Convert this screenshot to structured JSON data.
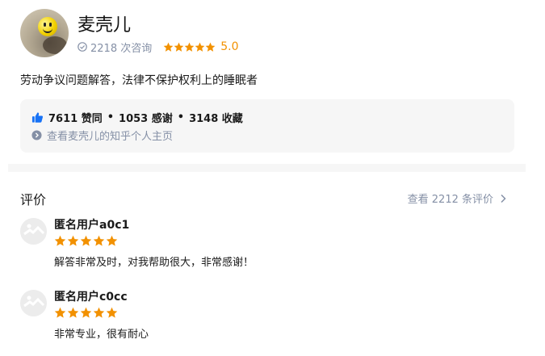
{
  "profile": {
    "name": "麦壳儿",
    "consult_count": "2218 次咨询",
    "rating_stars": 5,
    "rating_score": "5.0",
    "bio": "劳动争议问题解答，法律不保护权利上的睡眠者"
  },
  "stats": {
    "likes": "7611 赞同",
    "thanks": "1053 感谢",
    "favorites": "3148 收藏",
    "separator": "•",
    "profile_link": "查看麦壳儿的知乎个人主页"
  },
  "reviews_section": {
    "title": "评价",
    "view_all": "查看 2212 条评价",
    "items": [
      {
        "user": "匿名用户a0c1",
        "stars": 5,
        "text": "解答非常及时，对我帮助很大，非常感谢！"
      },
      {
        "user": "匿名用户c0cc",
        "stars": 5,
        "text": "非常专业，很有耐心"
      }
    ]
  },
  "colors": {
    "star": "#f29100",
    "muted_text": "#8590a6",
    "like_blue": "#1772f6",
    "card_bg": "#f6f6f6"
  },
  "icons": [
    "check-circle-icon",
    "star-icon",
    "thumbs-up-icon",
    "arrow-circle-right-icon",
    "chevron-right-icon",
    "avatar-placeholder-icon"
  ]
}
